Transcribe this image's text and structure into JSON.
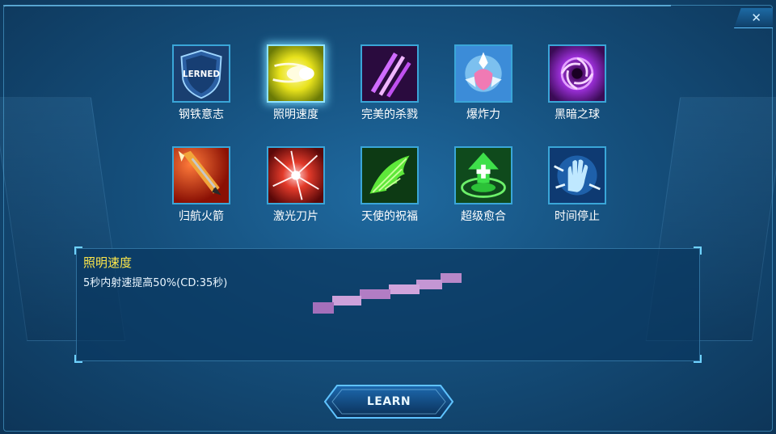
{
  "window": {
    "close_glyph": "✕"
  },
  "skills": [
    {
      "name": "钢铁意志",
      "icon": "shield-icon",
      "badge": "LERNED",
      "learned": true
    },
    {
      "name": "照明速度",
      "icon": "yellow-bullet-icon",
      "selected": true
    },
    {
      "name": "完美的杀戮",
      "icon": "purple-claw-icon"
    },
    {
      "name": "爆炸力",
      "icon": "crystal-burst-icon"
    },
    {
      "name": "黑暗之球",
      "icon": "dark-orb-icon"
    },
    {
      "name": "归航火箭",
      "icon": "rocket-icon"
    },
    {
      "name": "激光刀片",
      "icon": "laser-blade-icon"
    },
    {
      "name": "天使的祝福",
      "icon": "angel-wing-icon"
    },
    {
      "name": "超级愈合",
      "icon": "heal-arrow-icon"
    },
    {
      "name": "时间停止",
      "icon": "time-stop-hand-icon"
    }
  ],
  "description": {
    "title": "照明速度",
    "text": "5秒内射速提高50%(CD:35秒)"
  },
  "learn_button": {
    "label": "LEARN"
  },
  "colors": {
    "accent": "#3aa6d8",
    "title_yellow": "#ffe84a",
    "background": "#154f7c"
  }
}
